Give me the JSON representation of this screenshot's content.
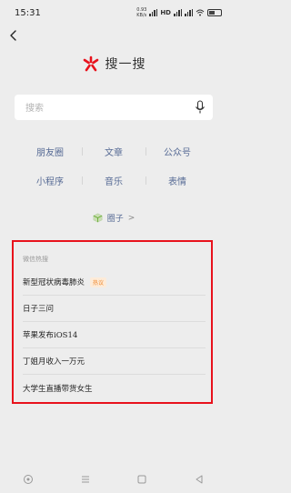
{
  "status_bar": {
    "time": "15:31",
    "speed_value": "0.93",
    "speed_unit": "KB/s",
    "hd_label": "HD"
  },
  "logo": {
    "text": "搜一搜",
    "accent_color": "#e8121c"
  },
  "search": {
    "placeholder": "搜索"
  },
  "categories": [
    [
      "朋友圈",
      "文章",
      "公众号"
    ],
    [
      "小程序",
      "音乐",
      "表情"
    ]
  ],
  "mini_program_link": {
    "label": "圈子",
    "chevron": ">"
  },
  "hot_search": {
    "title": "微信热搜",
    "items": [
      {
        "text": "新型冠状病毒肺炎",
        "badge": "热议"
      },
      {
        "text": "日子三问"
      },
      {
        "text": "苹果发布iOS14"
      },
      {
        "text": "丁姐月收入一万元"
      },
      {
        "text": "大学生直播带货女生"
      }
    ]
  },
  "highlight_color": "#e8121c",
  "link_color": "#576b95",
  "icons": {
    "back": "chevron-left-icon",
    "logo": "asterisk-logo-icon",
    "mic": "microphone-icon",
    "mini": "cube-icon",
    "nav": [
      "circle-nav-icon",
      "menu-nav-icon",
      "square-nav-icon",
      "triangle-back-nav-icon"
    ]
  }
}
